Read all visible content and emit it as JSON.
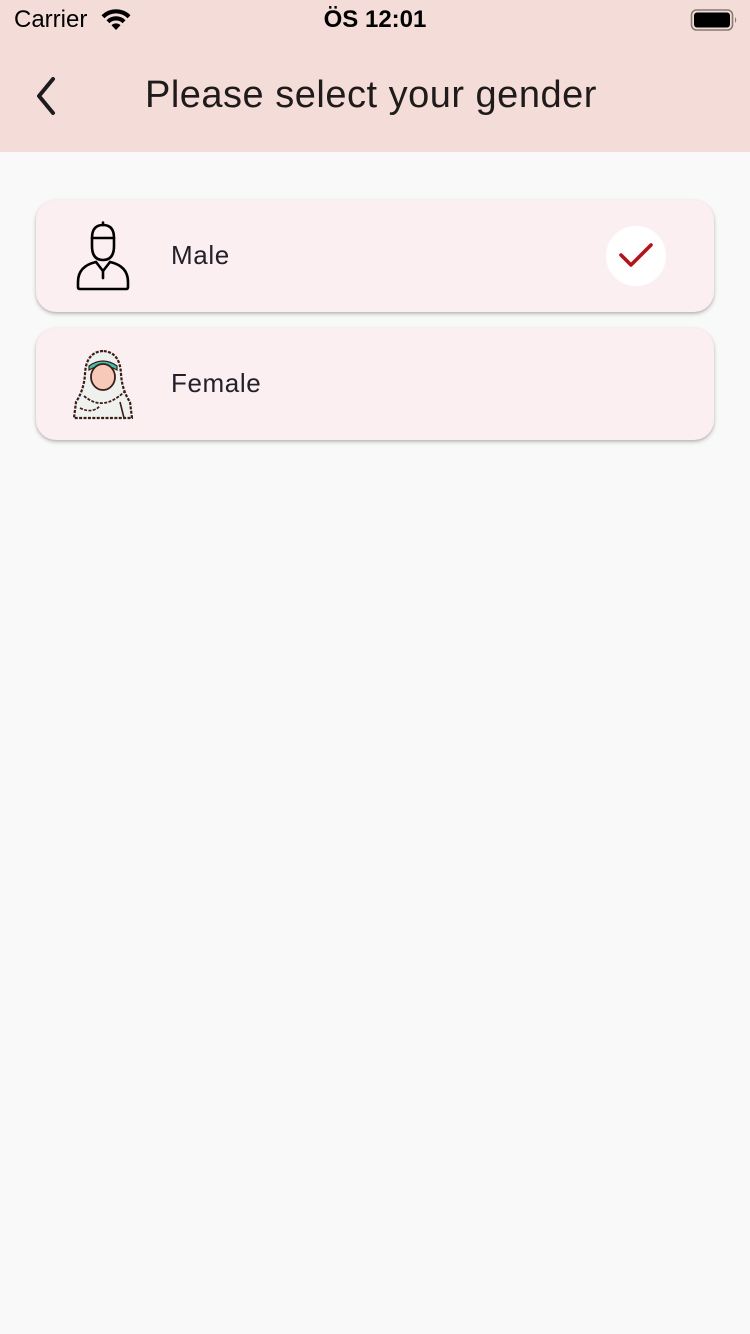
{
  "status_bar": {
    "carrier": "Carrier",
    "time": "ÖS 12:01",
    "wifi_icon": "wifi-icon",
    "battery_icon": "battery-full-icon"
  },
  "header": {
    "title": "Please select your gender",
    "back_icon": "chevron-left-icon",
    "background": "#f4ddd8"
  },
  "options": [
    {
      "label": "Male",
      "icon": "male-person-icon",
      "selected": true
    },
    {
      "label": "Female",
      "icon": "female-hijab-icon",
      "selected": false
    }
  ],
  "colors": {
    "card_background": "#fbeff2",
    "check_color": "#b3141b",
    "page_background": "#f9f9f9"
  }
}
